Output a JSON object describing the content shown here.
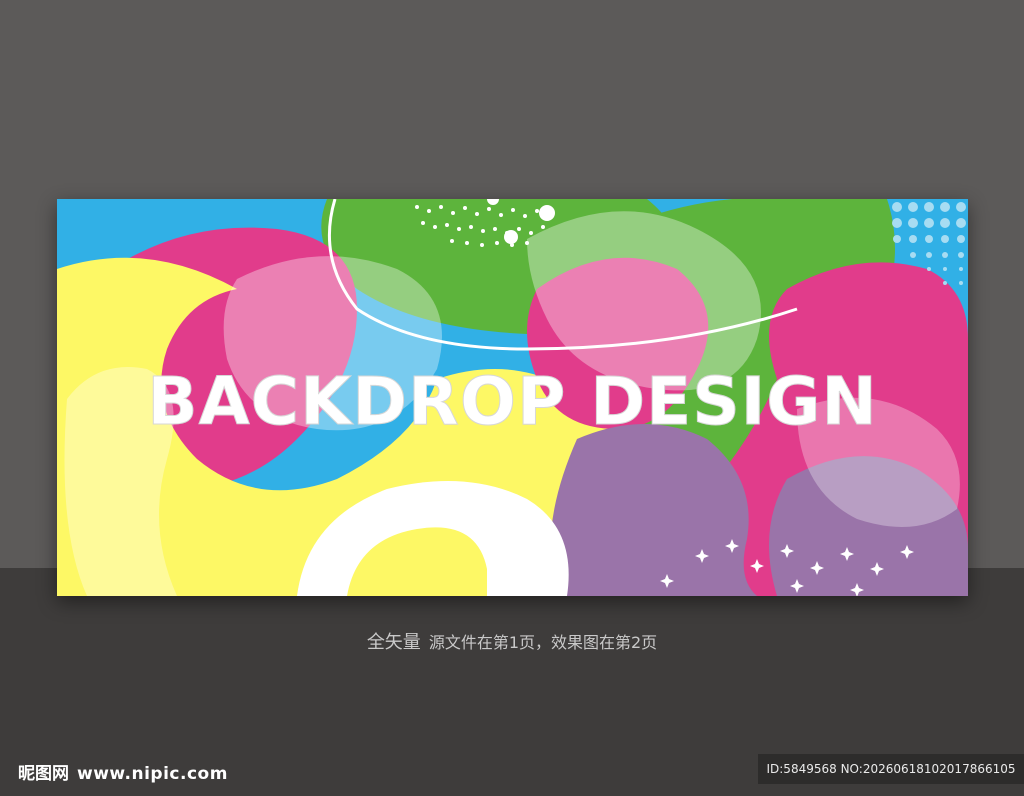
{
  "banner": {
    "headline": "BACKDROP DESIGN",
    "colors": {
      "blue": "#31b0e6",
      "green": "#5db43c",
      "pink": "#e13c8b",
      "yellow": "#fdf865",
      "purple": "#9a74a9",
      "white": "#ffffff"
    }
  },
  "caption": {
    "lead": "全矢量",
    "text": "源文件在第1页，效果图在第2页"
  },
  "watermark": {
    "site_name": "昵图网",
    "url": "www.nipic.com",
    "id_text": "ID:5849568 NO:20260618102017866105"
  }
}
